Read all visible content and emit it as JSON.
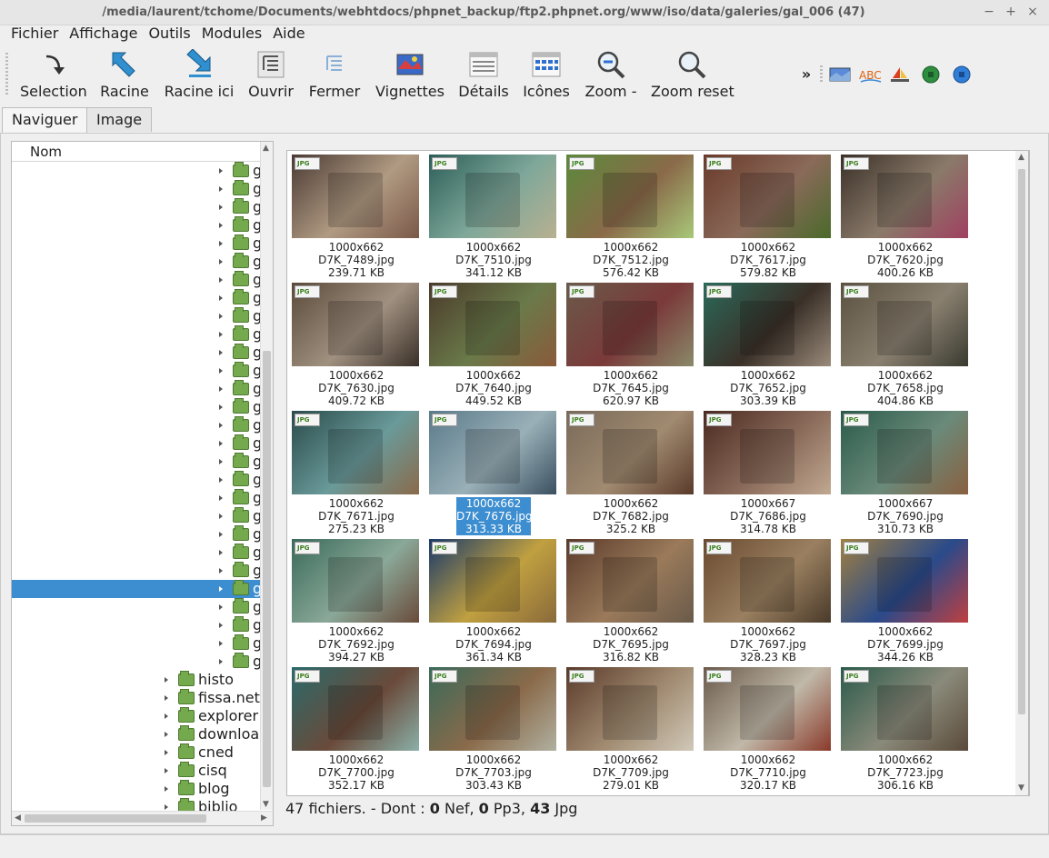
{
  "window": {
    "title": "/media/laurent/tchome/Documents/webhtdocs/phpnet_backup/ftp2.phpnet.org/www/iso/data/galeries/gal_006 (47)",
    "controls": [
      "−",
      "+",
      "×"
    ]
  },
  "menu": [
    "Fichier",
    "Affichage",
    "Outils",
    "Modules",
    "Aide"
  ],
  "toolbar": {
    "buttons": [
      "Selection",
      "Racine",
      "Racine ici",
      "Ouvrir",
      "Fermer",
      "Vignettes",
      "Détails",
      "Icônes",
      "Zoom -",
      "Zoom reset"
    ],
    "overflow": "»",
    "extra_icons": [
      "landscape-icon",
      "spellcheck-icon",
      "sailboat-icon",
      "green-dot-icon",
      "blue-dot-icon"
    ],
    "spellcheck_text": "ABC"
  },
  "tabs": [
    "Naviguer",
    "Image"
  ],
  "tree": {
    "header": "Nom",
    "gal_label": "g",
    "gal_count": 28,
    "selected_index": 23,
    "folders": [
      "histo",
      "fissa.net",
      "explorer",
      "download",
      "cned",
      "cisq",
      "blog",
      "biblio"
    ]
  },
  "gallery": {
    "items": [
      {
        "dim": "1000x662",
        "name": "D7K_7489.jpg",
        "size": "239.71 KB",
        "colors": [
          "#4a3a34",
          "#b09a82",
          "#7a5848"
        ]
      },
      {
        "dim": "1000x662",
        "name": "D7K_7510.jpg",
        "size": "341.12 KB",
        "colors": [
          "#2c5e58",
          "#7fa89a",
          "#b8b090"
        ]
      },
      {
        "dim": "1000x662",
        "name": "D7K_7512.jpg",
        "size": "576.42 KB",
        "colors": [
          "#5a8a3a",
          "#8a6a4a",
          "#a8c878"
        ]
      },
      {
        "dim": "1000x662",
        "name": "D7K_7617.jpg",
        "size": "579.82 KB",
        "colors": [
          "#6a3a2a",
          "#8a6a5a",
          "#4a6a2a"
        ]
      },
      {
        "dim": "1000x662",
        "name": "D7K_7620.jpg",
        "size": "400.26 KB",
        "colors": [
          "#3a3028",
          "#8a7a6a",
          "#a04060"
        ]
      },
      {
        "dim": "1000x662",
        "name": "D7K_7630.jpg",
        "size": "409.72 KB",
        "colors": [
          "#5a4a3a",
          "#a09080",
          "#3a3028"
        ]
      },
      {
        "dim": "1000x662",
        "name": "D7K_7640.jpg",
        "size": "449.52 KB",
        "colors": [
          "#4a3a2a",
          "#6a7a4a",
          "#8a5a3a"
        ]
      },
      {
        "dim": "1000x662",
        "name": "D7K_7645.jpg",
        "size": "620.97 KB",
        "colors": [
          "#6a5a4a",
          "#7a3a3a",
          "#8a8a6a"
        ]
      },
      {
        "dim": "1000x662",
        "name": "D7K_7652.jpg",
        "size": "303.39 KB",
        "colors": [
          "#2a6a5a",
          "#3a3028",
          "#9a8a7a"
        ]
      },
      {
        "dim": "1000x662",
        "name": "D7K_7658.jpg",
        "size": "404.86 KB",
        "colors": [
          "#5a5040",
          "#8a8070",
          "#3a3a30"
        ]
      },
      {
        "dim": "1000x662",
        "name": "D7K_7671.jpg",
        "size": "275.23 KB",
        "colors": [
          "#2a4a4a",
          "#6a9a9a",
          "#8a6a4a"
        ]
      },
      {
        "dim": "1000x662",
        "name": "D7K_7676.jpg",
        "size": "313.33 KB",
        "colors": [
          "#5a7a8a",
          "#9ab0b8",
          "#3a5060"
        ]
      },
      {
        "dim": "1000x662",
        "name": "D7K_7682.jpg",
        "size": "325.2 KB",
        "colors": [
          "#7a6a5a",
          "#a08a70",
          "#5a3a2a"
        ]
      },
      {
        "dim": "1000x667",
        "name": "D7K_7686.jpg",
        "size": "314.78 KB",
        "colors": [
          "#4a2a20",
          "#8a6a5a",
          "#c0a890"
        ]
      },
      {
        "dim": "1000x667",
        "name": "D7K_7690.jpg",
        "size": "310.73 KB",
        "colors": [
          "#2a5a4a",
          "#6a8a7a",
          "#8a6040"
        ]
      },
      {
        "dim": "1000x662",
        "name": "D7K_7692.jpg",
        "size": "394.27 KB",
        "colors": [
          "#3a6a5a",
          "#8aa898",
          "#6a4a3a"
        ]
      },
      {
        "dim": "1000x662",
        "name": "D7K_7694.jpg",
        "size": "361.34 KB",
        "colors": [
          "#1a3a6a",
          "#c0a040",
          "#8a6a3a"
        ]
      },
      {
        "dim": "1000x662",
        "name": "D7K_7695.jpg",
        "size": "316.82 KB",
        "colors": [
          "#5a3a2a",
          "#9a7a5a",
          "#6a5a4a"
        ]
      },
      {
        "dim": "1000x662",
        "name": "D7K_7697.jpg",
        "size": "328.23 KB",
        "colors": [
          "#6a4a30",
          "#9a8060",
          "#4a3a2a"
        ]
      },
      {
        "dim": "1000x662",
        "name": "D7K_7699.jpg",
        "size": "344.26 KB",
        "colors": [
          "#a08040",
          "#2a4a8a",
          "#c04040"
        ]
      },
      {
        "dim": "1000x662",
        "name": "D7K_7700.jpg",
        "size": "352.17 KB",
        "colors": [
          "#2a6a6a",
          "#6a4a3a",
          "#8ab0a8"
        ]
      },
      {
        "dim": "1000x662",
        "name": "D7K_7703.jpg",
        "size": "303.43 KB",
        "colors": [
          "#3a6a5a",
          "#8a6a4a",
          "#b0b0a0"
        ]
      },
      {
        "dim": "1000x662",
        "name": "D7K_7709.jpg",
        "size": "279.01 KB",
        "colors": [
          "#5a3a2a",
          "#a08a70",
          "#d0c8b8"
        ]
      },
      {
        "dim": "1000x662",
        "name": "D7K_7710.jpg",
        "size": "320.17 KB",
        "colors": [
          "#6a5a4a",
          "#c0b8a8",
          "#8a3a2a"
        ]
      },
      {
        "dim": "1000x662",
        "name": "D7K_7723.jpg",
        "size": "306.16 KB",
        "colors": [
          "#2a5a4a",
          "#8a8a7a",
          "#5a4a3a"
        ]
      }
    ],
    "selected_index": 11,
    "badge": "JPG"
  },
  "status": {
    "files": "47 fichiers. - Dont :",
    "nef_count": "0",
    "nef_label": "Nef,",
    "pp3_count": "0",
    "pp3_label": "Pp3,",
    "jpg_count": "43",
    "jpg_label": "Jpg"
  },
  "colors": {
    "selection": "#3d8ed0",
    "folder": "#75a94e",
    "toolbar_blue": "#2f8fcf"
  }
}
